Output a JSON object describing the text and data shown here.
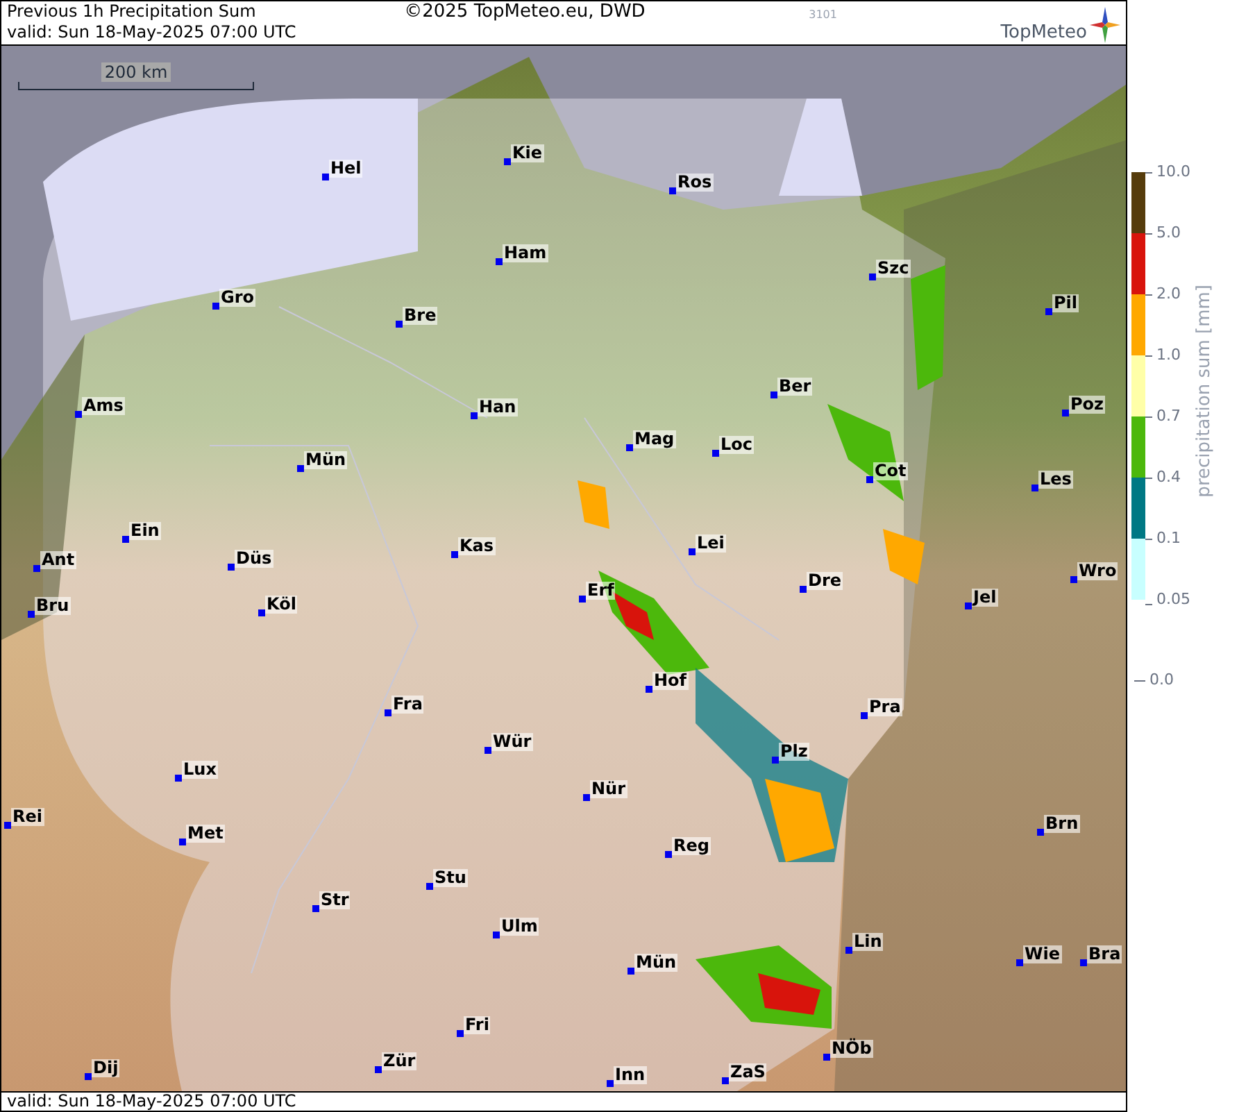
{
  "header": {
    "title": "Previous 1h Precipitation Sum",
    "valid": "valid:  Sun  18-May-2025 07:00 UTC",
    "copyright": "©2025 TopMeteo.eu, DWD",
    "code": "3101",
    "logo": "TopMeteo"
  },
  "map": {
    "scale": "200 km",
    "cities": [
      {
        "name": "Kie"
      },
      {
        "name": "Hel"
      },
      {
        "name": "Ros"
      },
      {
        "name": "Ham"
      },
      {
        "name": "Szc"
      },
      {
        "name": "Gro"
      },
      {
        "name": "Pil"
      },
      {
        "name": "Bre"
      },
      {
        "name": "Ber"
      },
      {
        "name": "Ams"
      },
      {
        "name": "Han"
      },
      {
        "name": "Poz"
      },
      {
        "name": "Mag"
      },
      {
        "name": "Loc"
      },
      {
        "name": "Mün"
      },
      {
        "name": "Cot"
      },
      {
        "name": "Les"
      },
      {
        "name": "Ein"
      },
      {
        "name": "Kas"
      },
      {
        "name": "Lei"
      },
      {
        "name": "Ant"
      },
      {
        "name": "Düs"
      },
      {
        "name": "Bru"
      },
      {
        "name": "Köl"
      },
      {
        "name": "Erf"
      },
      {
        "name": "Dre"
      },
      {
        "name": "Jel"
      },
      {
        "name": "Wro"
      },
      {
        "name": "Hof"
      },
      {
        "name": "Fra"
      },
      {
        "name": "Pra"
      },
      {
        "name": "Wür"
      },
      {
        "name": "Plz"
      },
      {
        "name": "Lux"
      },
      {
        "name": "Nür"
      },
      {
        "name": "Rei"
      },
      {
        "name": "Met"
      },
      {
        "name": "Brn"
      },
      {
        "name": "Reg"
      },
      {
        "name": "Stu"
      },
      {
        "name": "Str"
      },
      {
        "name": "Ulm"
      },
      {
        "name": "Lin"
      },
      {
        "name": "Mün"
      },
      {
        "name": "Wie"
      },
      {
        "name": "Bra"
      },
      {
        "name": "Fri"
      },
      {
        "name": "Dij"
      },
      {
        "name": "Zür"
      },
      {
        "name": "Inn"
      },
      {
        "name": "ZaS"
      },
      {
        "name": "NÖb"
      }
    ]
  },
  "footer": {
    "valid": "valid:  Sun  18-May-2025 07:00 UTC"
  },
  "legend": {
    "label": "precipitation sum [mm]",
    "segments": [
      {
        "color": "#563c0c"
      },
      {
        "color": "#d8140c"
      },
      {
        "color": "#ffa800"
      },
      {
        "color": "#ffffa8"
      },
      {
        "color": "#4cb80c"
      },
      {
        "color": "#007884"
      },
      {
        "color": "#c8ffff"
      }
    ],
    "ticks": [
      "10.0",
      "5.0",
      "2.0",
      "1.0",
      "0.7",
      "0.4",
      "0.1",
      "0.05"
    ],
    "zero": "0.0"
  }
}
